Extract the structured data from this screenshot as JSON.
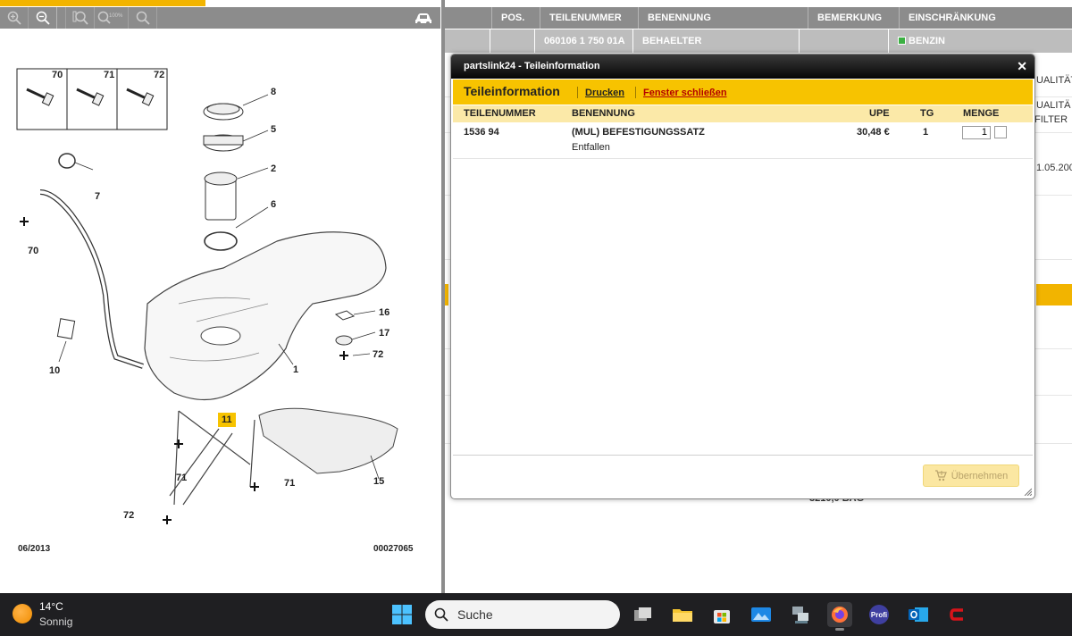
{
  "toolbar": {
    "zoom_in_icon": "zoom-in-icon",
    "zoom_out_icon": "zoom-out-icon",
    "zoom_fit_icon": "zoom-fit-icon",
    "zoom_100_label": "100%",
    "zoom_reset_icon": "zoom-reset-icon",
    "vehicle_icon": "car-icon"
  },
  "diagram": {
    "legend_callouts": [
      "70",
      "71",
      "72"
    ],
    "callouts": [
      "8",
      "5",
      "2",
      "6",
      "7",
      "70",
      "16",
      "17",
      "72",
      "10",
      "1",
      "11",
      "71",
      "15",
      "71",
      "72"
    ],
    "highlighted_callout": "11",
    "date": "06/2013",
    "code": "00027065"
  },
  "table": {
    "headers": [
      "POS.",
      "TEILENUMMER",
      "BENENNUNG",
      "BEMERKUNG",
      "EINSCHRÄNKUNG"
    ],
    "row1": {
      "teilenummer": "060106 1 750 01A",
      "benennung": "BEHAELTER",
      "einschraenkung": "BENZIN"
    },
    "partial_texts": [
      "UALITÄT",
      "UALITÄ",
      "FILTER",
      "1.05.200"
    ],
    "bottom_partial": "3210,0 BAG"
  },
  "modal": {
    "title": "partslink24 - Teileinformation",
    "heading": "Teileinformation",
    "print_link": "Drucken",
    "close_window_link": "Fenster schließen",
    "columns": [
      "TEILENUMMER",
      "BENENNUNG",
      "UPE",
      "TG",
      "MENGE"
    ],
    "row": {
      "teilenummer": "1536 94",
      "benennung": "(MUL) BEFESTIGUNGSSATZ",
      "benennung_sub": "Entfallen",
      "upe": "30,48 €",
      "tg": "1",
      "menge": "1"
    },
    "take_over_button": "Übernehmen"
  },
  "taskbar": {
    "weather_temp": "14°C",
    "weather_desc": "Sonnig",
    "search_label": "Suche",
    "apps": [
      "task-view-icon",
      "file-explorer-icon",
      "microsoft-store-icon",
      "photos-icon",
      "network-tool-icon",
      "firefox-icon",
      "profi-icon",
      "outlook-icon",
      "red-app-icon"
    ],
    "profi_label": "Profi"
  },
  "colors": {
    "accent_yellow": "#f7c300",
    "toolbar_gray": "#8c8c8c",
    "link_red": "#b30000"
  }
}
